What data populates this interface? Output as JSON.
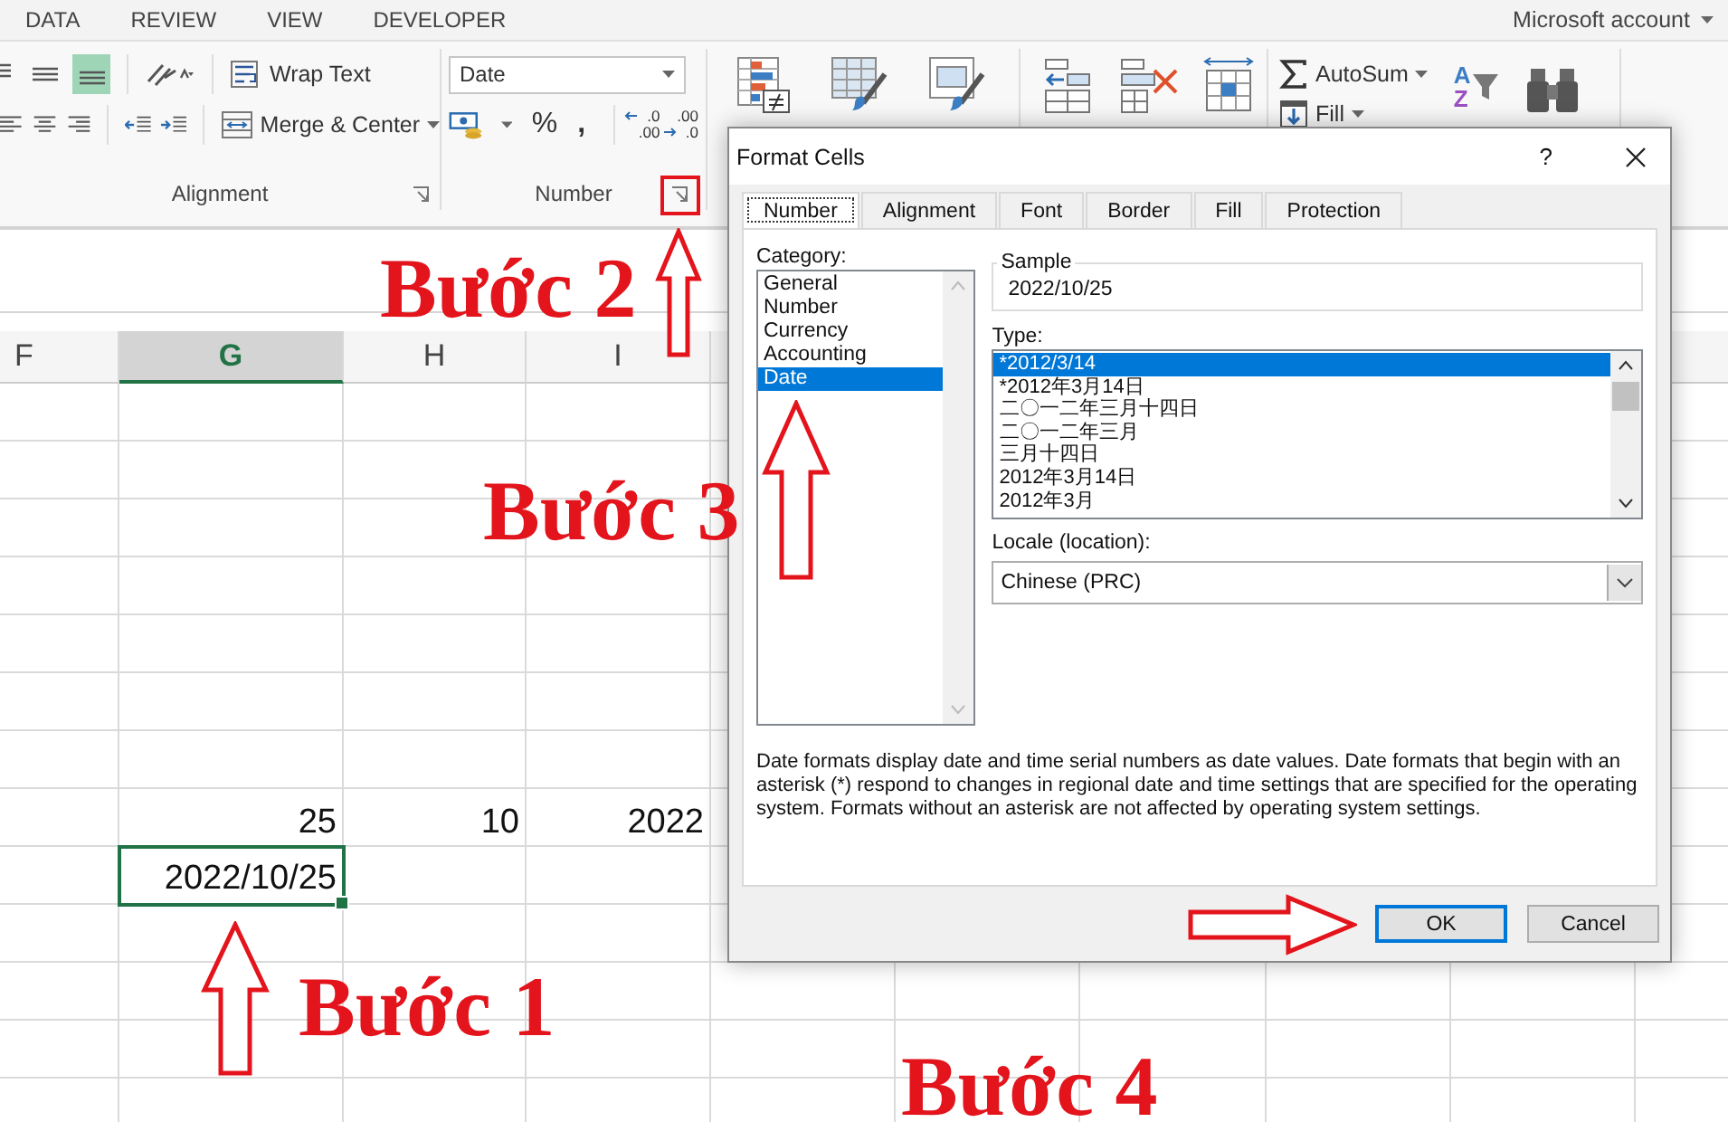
{
  "ribbon_tabs": [
    {
      "label": "DATA"
    },
    {
      "label": "REVIEW"
    },
    {
      "label": "VIEW"
    },
    {
      "label": "DEVELOPER"
    }
  ],
  "account": {
    "label": "Microsoft account"
  },
  "ribbon": {
    "alignment": {
      "label": "Alignment",
      "vertical_align": [
        {
          "selected": false
        },
        {
          "selected": false
        },
        {
          "selected": true
        }
      ],
      "wrap_text": "Wrap Text",
      "merge": "Merge & Center"
    },
    "number": {
      "label": "Number",
      "format": "Date",
      "percent": "%",
      "comma": ",",
      "decimals": [
        {
          "kind": "increase",
          "lines": [
            ".0",
            ".00"
          ]
        },
        {
          "kind": "decrease",
          "lines": [
            ".00",
            ".0"
          ]
        }
      ]
    },
    "editing": {
      "autosum": "AutoSum",
      "fill": "Fill",
      "sort_letters": [
        "A",
        "Z"
      ]
    }
  },
  "sheet": {
    "columns": [
      {
        "label": "F",
        "selected": false
      },
      {
        "label": "G",
        "selected": true
      },
      {
        "label": "H",
        "selected": false
      },
      {
        "label": "I",
        "selected": false
      }
    ],
    "rows": [
      {
        "cells": [
          null,
          {
            "value": "25",
            "selected": false
          },
          {
            "value": "10",
            "selected": false
          },
          {
            "value": "2022",
            "selected": false
          }
        ]
      },
      {
        "cells": [
          null,
          {
            "value": "2022/10/25",
            "selected": true
          },
          null,
          null
        ]
      }
    ]
  },
  "dialog": {
    "title": "Format Cells",
    "help": "?",
    "tabs": [
      {
        "label": "Number",
        "selected": true
      },
      {
        "label": "Alignment",
        "selected": false
      },
      {
        "label": "Font",
        "selected": false
      },
      {
        "label": "Border",
        "selected": false
      },
      {
        "label": "Fill",
        "selected": false
      },
      {
        "label": "Protection",
        "selected": false
      }
    ],
    "category": {
      "label": "Category:",
      "items": [
        {
          "label": "General",
          "selected": false
        },
        {
          "label": "Number",
          "selected": false
        },
        {
          "label": "Currency",
          "selected": false
        },
        {
          "label": "Accounting",
          "selected": false
        },
        {
          "label": "Date",
          "selected": true
        }
      ]
    },
    "sample": {
      "label": "Sample",
      "value": "2022/10/25"
    },
    "type": {
      "label": "Type:",
      "items": [
        {
          "label": "*2012/3/14",
          "selected": true
        },
        {
          "label": "*2012年3月14日",
          "selected": false
        },
        {
          "label": "二〇一二年三月十四日",
          "selected": false
        },
        {
          "label": "二〇一二年三月",
          "selected": false
        },
        {
          "label": "三月十四日",
          "selected": false
        },
        {
          "label": "2012年3月14日",
          "selected": false
        },
        {
          "label": "2012年3月",
          "selected": false
        }
      ]
    },
    "locale": {
      "label": "Locale (location):",
      "value": "Chinese (PRC)"
    },
    "description": "Date formats display date and time serial numbers as date values. Date formats that begin with an asterisk (*) respond to changes in regional date and time settings that are specified for the operating system. Formats without an asterisk are not affected by operating system settings.",
    "buttons": [
      {
        "label": "OK",
        "default": true
      },
      {
        "label": "Cancel",
        "default": false
      }
    ]
  },
  "annotations": [
    {
      "kind": "step",
      "text": "Bước 2"
    },
    {
      "kind": "step",
      "text": "Bước 3"
    },
    {
      "kind": "step",
      "text": "Bước 1"
    },
    {
      "kind": "step",
      "text": "Bước 4"
    }
  ]
}
